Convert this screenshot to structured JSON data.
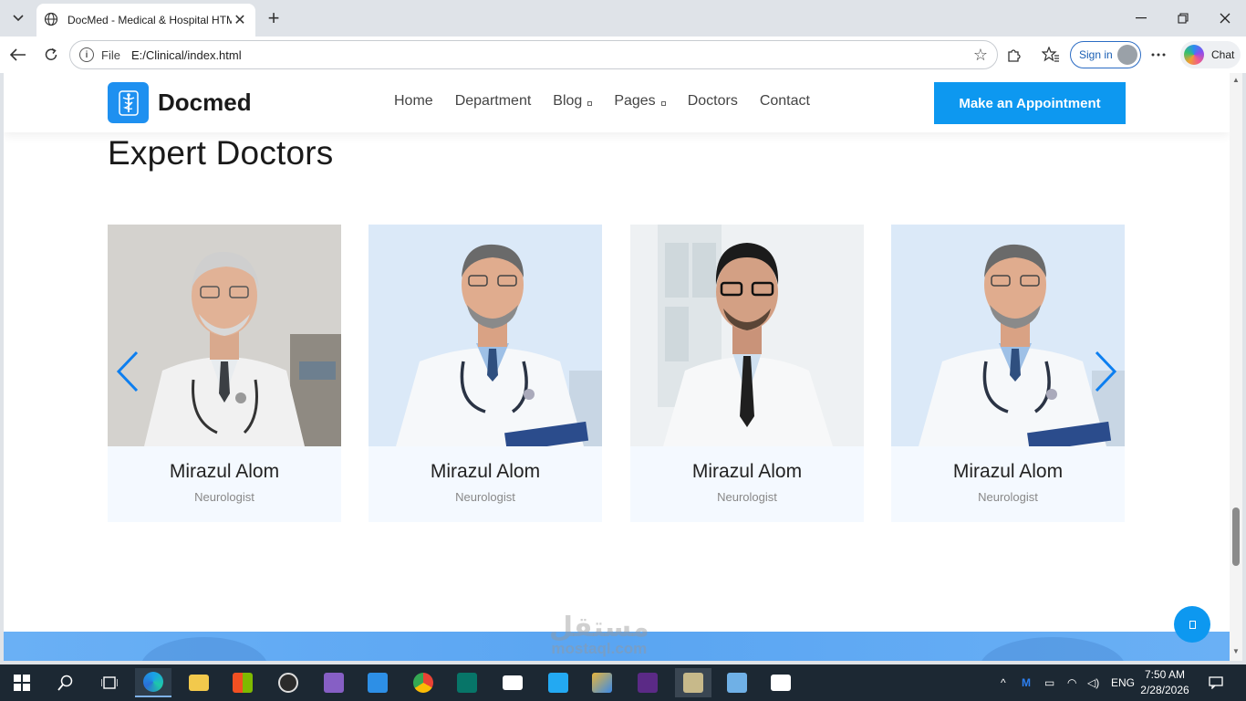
{
  "browser": {
    "tab_title": "DocMed - Medical & Hospital HTML",
    "address_prefix": "File",
    "url": "E:/Clinical/index.html",
    "signin_label": "Sign in",
    "chat_label": "Chat"
  },
  "site": {
    "brand": "Docmed",
    "nav": {
      "home": "Home",
      "department": "Department",
      "blog": "Blog",
      "pages": "Pages",
      "doctors": "Doctors",
      "contact": "Contact"
    },
    "appointment_button": "Make an Appointment",
    "section_title": "Expert Doctors",
    "doctors": [
      {
        "name": "Mirazul Alom",
        "role": "Neurologist"
      },
      {
        "name": "Mirazul Alom",
        "role": "Neurologist"
      },
      {
        "name": "Mirazul Alom",
        "role": "Neurologist"
      },
      {
        "name": "Mirazul Alom",
        "role": "Neurologist"
      }
    ]
  },
  "watermark": {
    "arabic": "مستقل",
    "latin": "mostaql.com"
  },
  "taskbar": {
    "language": "ENG",
    "time": "7:50 AM",
    "date": "2/28/2026"
  },
  "colors": {
    "accent": "#0d98f0",
    "card_bg": "#f4f9ff",
    "taskbar": "#1c2833"
  }
}
